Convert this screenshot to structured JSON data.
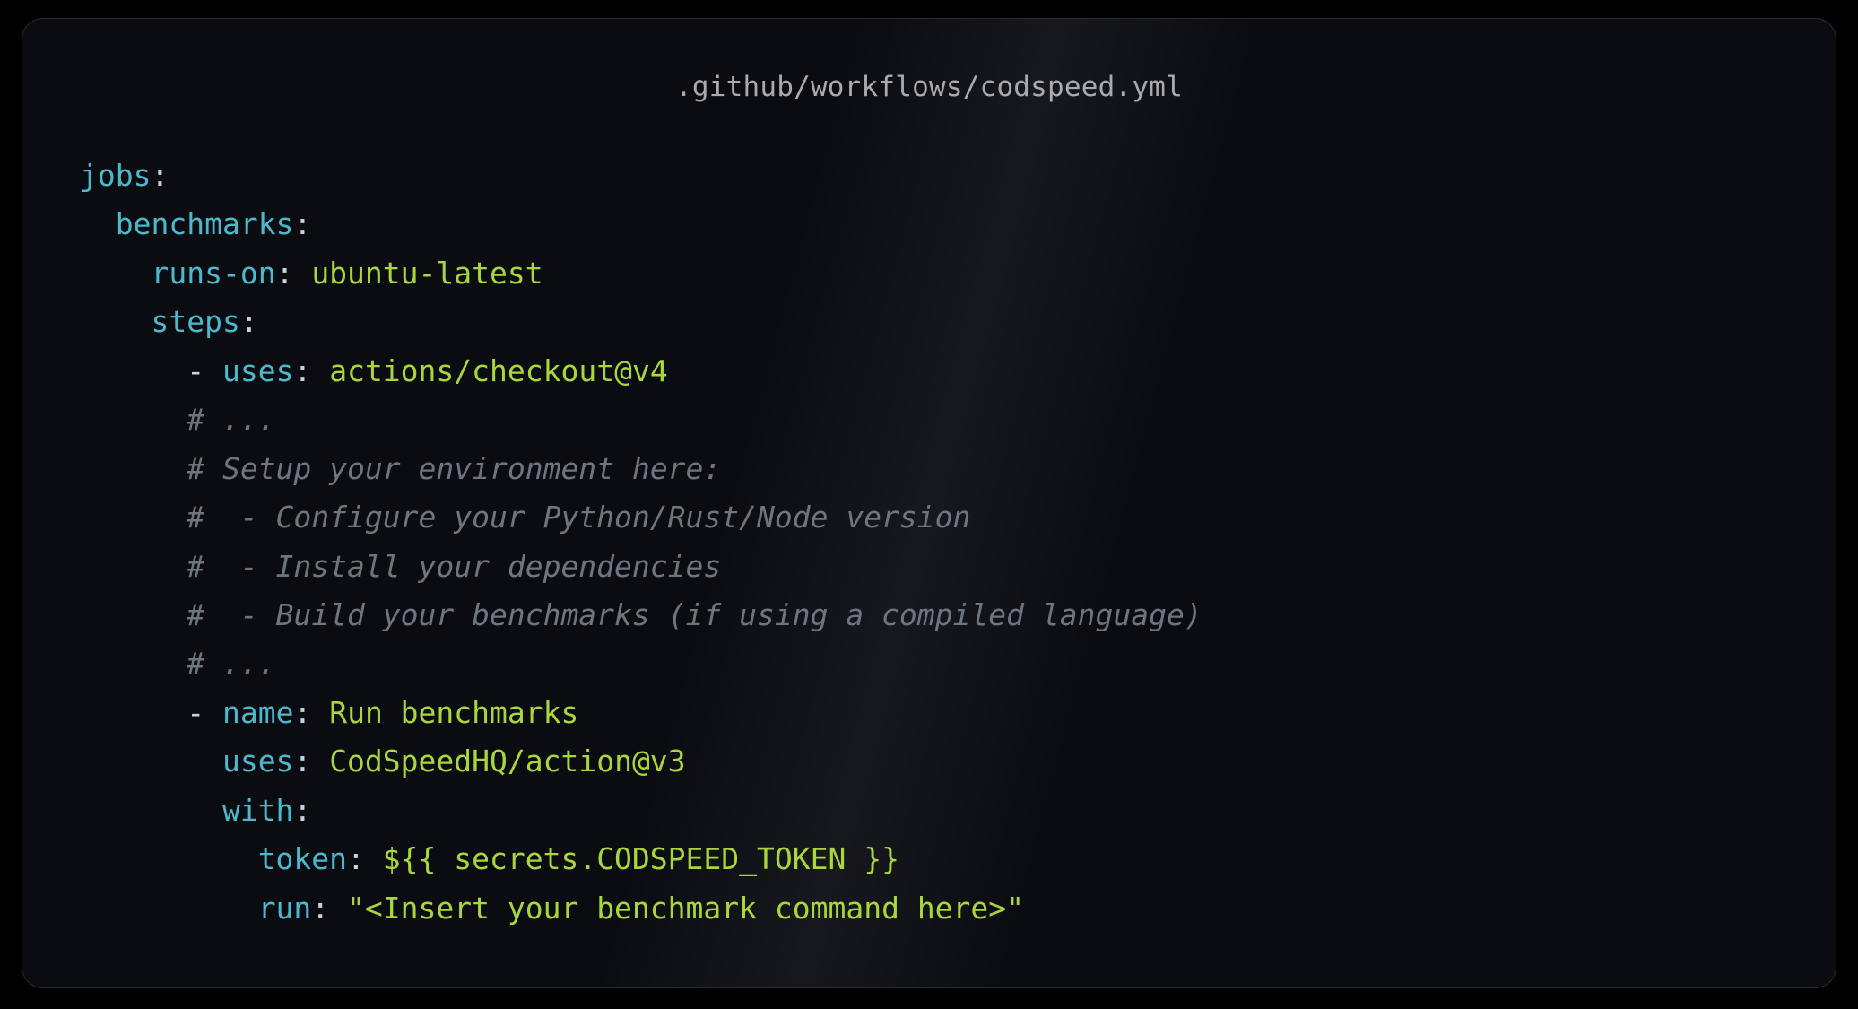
{
  "filename": ".github/workflows/codspeed.yml",
  "code": {
    "l1_key": "jobs",
    "l2_key": "benchmarks",
    "l3_key": "runs-on",
    "l3_val": "ubuntu-latest",
    "l4_key": "steps",
    "l5_key": "uses",
    "l5_val": "actions/checkout@v4",
    "c1": "# ...",
    "c2": "# Setup your environment here:",
    "c3": "#  - Configure your Python/Rust/Node version",
    "c4": "#  - Install your dependencies",
    "c5": "#  - Build your benchmarks (if using a compiled language)",
    "c6": "# ...",
    "l12_key": "name",
    "l12_val": "Run benchmarks",
    "l13_key": "uses",
    "l13_val": "CodSpeedHQ/action@v3",
    "l14_key": "with",
    "l15_key": "token",
    "l15_val": "${{ secrets.CODSPEED_TOKEN }}",
    "l16_key": "run",
    "l16_val": "\"<Insert your benchmark command here>\""
  }
}
